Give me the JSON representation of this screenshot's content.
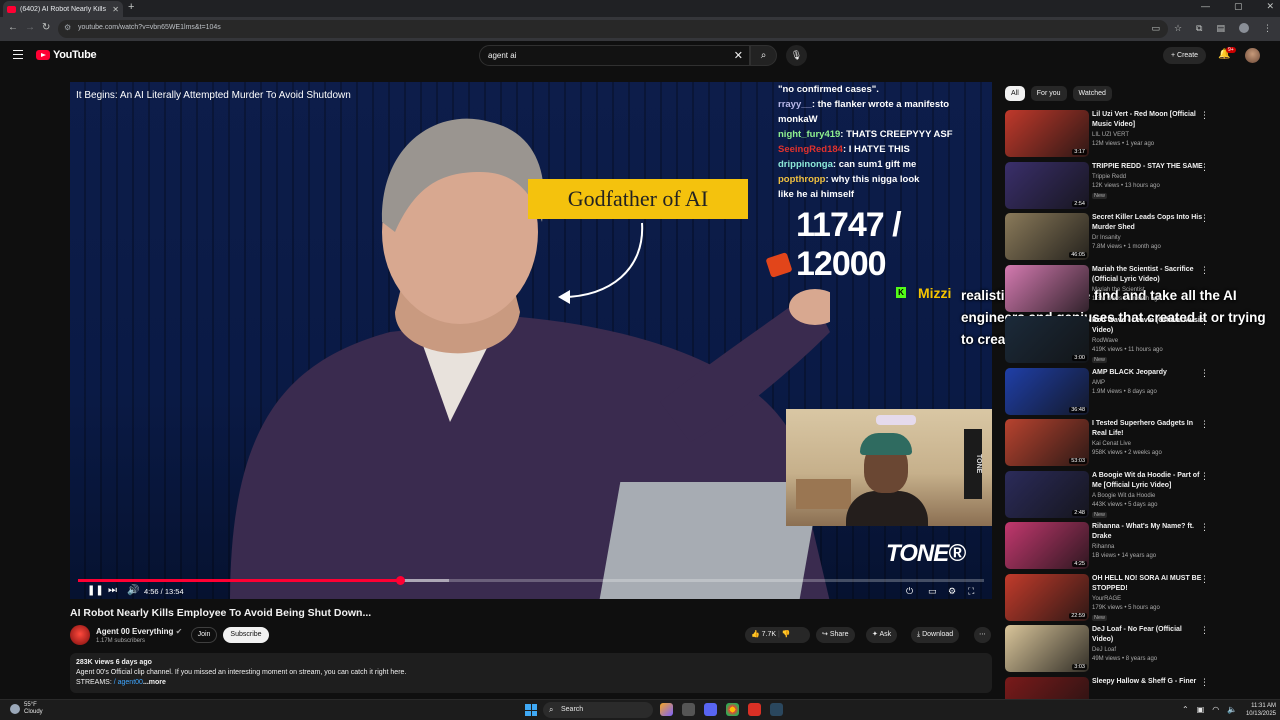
{
  "browser": {
    "tab_title": "(6402) AI Robot Nearly Kills",
    "url": "youtube.com/watch?v=vbn65WE1lms&t=104s"
  },
  "header": {
    "logo_text": "YouTube",
    "search_value": "agent ai",
    "create_label": "Create",
    "notifications_badge": "9+"
  },
  "player": {
    "video_title": "It Begins: An AI Literally Attempted Murder To Avoid Shutdown",
    "banner_text": "Godfather of AI",
    "counter_text": "11747 / 12000",
    "watermark": "TONE",
    "current_time": "4:56",
    "duration": "13:54",
    "time_display": "4:56 / 13:54",
    "progress_fraction": 0.355,
    "buffered_fraction": 0.41,
    "chat": [
      {
        "user": "",
        "text": "\"no confirmed cases\"."
      },
      {
        "user": "rrayy__",
        "text": ": the flanker wrote a manifesto"
      },
      {
        "user": "",
        "text": "monkaW"
      },
      {
        "user": "night_fury419",
        "text": ": THATS CREEPYYY ASF"
      },
      {
        "user": "SeeingRed184",
        "text": ": I HATYE THIS"
      },
      {
        "user": "drippinonga",
        "text": ": can sum1 gift me"
      },
      {
        "user": "popthropp",
        "text": ": why this nigga look"
      },
      {
        "user": "",
        "text": "like he ai himself"
      }
    ]
  },
  "overlay_message": {
    "badge": "K",
    "user": "Mizzi",
    "text": "realistically i say we find and take all the AI engineers and geniuses that created it or trying to create it"
  },
  "watch": {
    "title": "AI Robot Nearly Kills Employee To Avoid Being Shut Down...",
    "channel_name": "Agent 00 Everything",
    "subscribers": "1.17M subscribers",
    "join_label": "Join",
    "subscribe_label": "Subscribe",
    "likes": "7.7K",
    "share_label": "Share",
    "ask_label": "Ask",
    "download_label": "Download",
    "desc_meta": "283K views  6 days ago",
    "desc_line1": "Agent 00's Official clip channel. If you missed an interesting moment on stream, you can catch it right here.",
    "desc_line2_prefix": "STREAMS: ",
    "desc_line2_link": "/ agent00",
    "desc_more": "...more"
  },
  "sidebar": {
    "chips": [
      "All",
      "For you",
      "Watched"
    ],
    "recommendations": [
      {
        "title": "Lil Uzi Vert - Red Moon [Official Music Video]",
        "channel": "LIL UZI VERT",
        "stats": "12M views • 1 year ago",
        "duration": "3:17",
        "badge": "",
        "color": "#c0392b"
      },
      {
        "title": "TRIPPIE REDD - STAY THE SAME",
        "channel": "Trippie Redd",
        "stats": "12K views • 13 hours ago",
        "duration": "2:54",
        "badge": "New",
        "color": "#3a2f6b"
      },
      {
        "title": "Secret Killer Leads Cops Into His Murder Shed",
        "channel": "Dr Insanity",
        "stats": "7.8M views • 1 month ago",
        "duration": "46:05",
        "badge": "",
        "color": "#8a7a5a"
      },
      {
        "title": "Mariah the Scientist - Sacrifice (Official Lyric Video)",
        "channel": "Mariah the Scientist",
        "stats": "1.3M views • 1 month ago",
        "duration": "",
        "badge": "",
        "color": "#d47ab0"
      },
      {
        "title": "Rod Wave - Leavin (Official Music Video)",
        "channel": "RodWave",
        "stats": "419K views • 11 hours ago",
        "duration": "3:00",
        "badge": "New",
        "color": "#1b2a3a"
      },
      {
        "title": "AMP BLACK Jeopardy",
        "channel": "AMP",
        "stats": "1.9M views • 8 days ago",
        "duration": "36:48",
        "badge": "",
        "color": "#1f3fa8"
      },
      {
        "title": "I Tested Superhero Gadgets In Real Life!",
        "channel": "Kai Cenat Live",
        "stats": "958K views • 2 weeks ago",
        "duration": "53:03",
        "badge": "",
        "color": "#b8432f"
      },
      {
        "title": "A Boogie Wit da Hoodie - Part of Me [Official Lyric Video]",
        "channel": "A Boogie Wit da Hoodie",
        "stats": "443K views • 5 days ago",
        "duration": "2:48",
        "badge": "New",
        "color": "#2b2b5a"
      },
      {
        "title": "Rihanna - What's My Name? ft. Drake",
        "channel": "Rihanna",
        "stats": "1B views • 14 years ago",
        "duration": "4:25",
        "badge": "",
        "color": "#c2386e"
      },
      {
        "title": "OH HELL NO! SORA AI MUST BE STOPPED!",
        "channel": "YourRAGE",
        "stats": "179K views • 5 hours ago",
        "duration": "22:59",
        "badge": "New",
        "color": "#c23b2b"
      },
      {
        "title": "DeJ Loaf - No Fear (Official Video)",
        "channel": "DeJ Loaf",
        "stats": "49M views • 8 years ago",
        "duration": "3:03",
        "badge": "",
        "color": "#d9c59a"
      },
      {
        "title": "Sleepy Hallow & Sheff G - Finer",
        "channel": "",
        "stats": "",
        "duration": "",
        "badge": "",
        "color": "#7a1a1a"
      }
    ]
  },
  "taskbar": {
    "weather_temp": "55°F",
    "weather_desc": "Cloudy",
    "search_label": "Search",
    "time": "11:31 AM",
    "date": "10/13/2025"
  },
  "colors": {
    "yt_red": "#ff0033",
    "background": "#0f0f0f",
    "overlay_username": "#f5c400",
    "kick_green": "#53fc18"
  }
}
